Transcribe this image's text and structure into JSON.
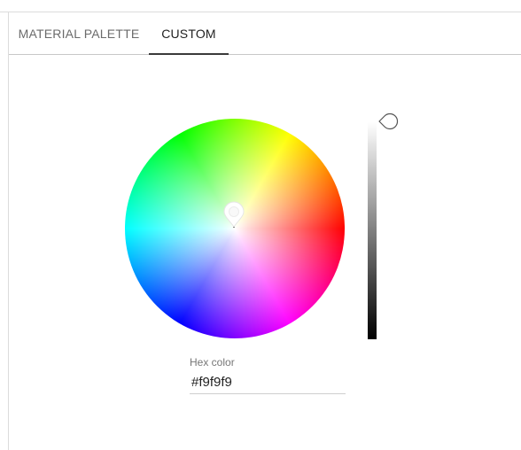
{
  "tabs": [
    {
      "label": "MATERIAL PALETTE",
      "active": false
    },
    {
      "label": "CUSTOM",
      "active": true
    }
  ],
  "picker": {
    "hex_label": "Hex color",
    "hex_value": "#f9f9f9",
    "brightness_level": 1.0
  },
  "colors": {
    "active_tab_underline": "#3a3a3a",
    "selected_color": "#f9f9f9"
  },
  "icons": {
    "wheel_marker": "color-marker-icon",
    "slider_handle": "slider-handle-icon"
  }
}
